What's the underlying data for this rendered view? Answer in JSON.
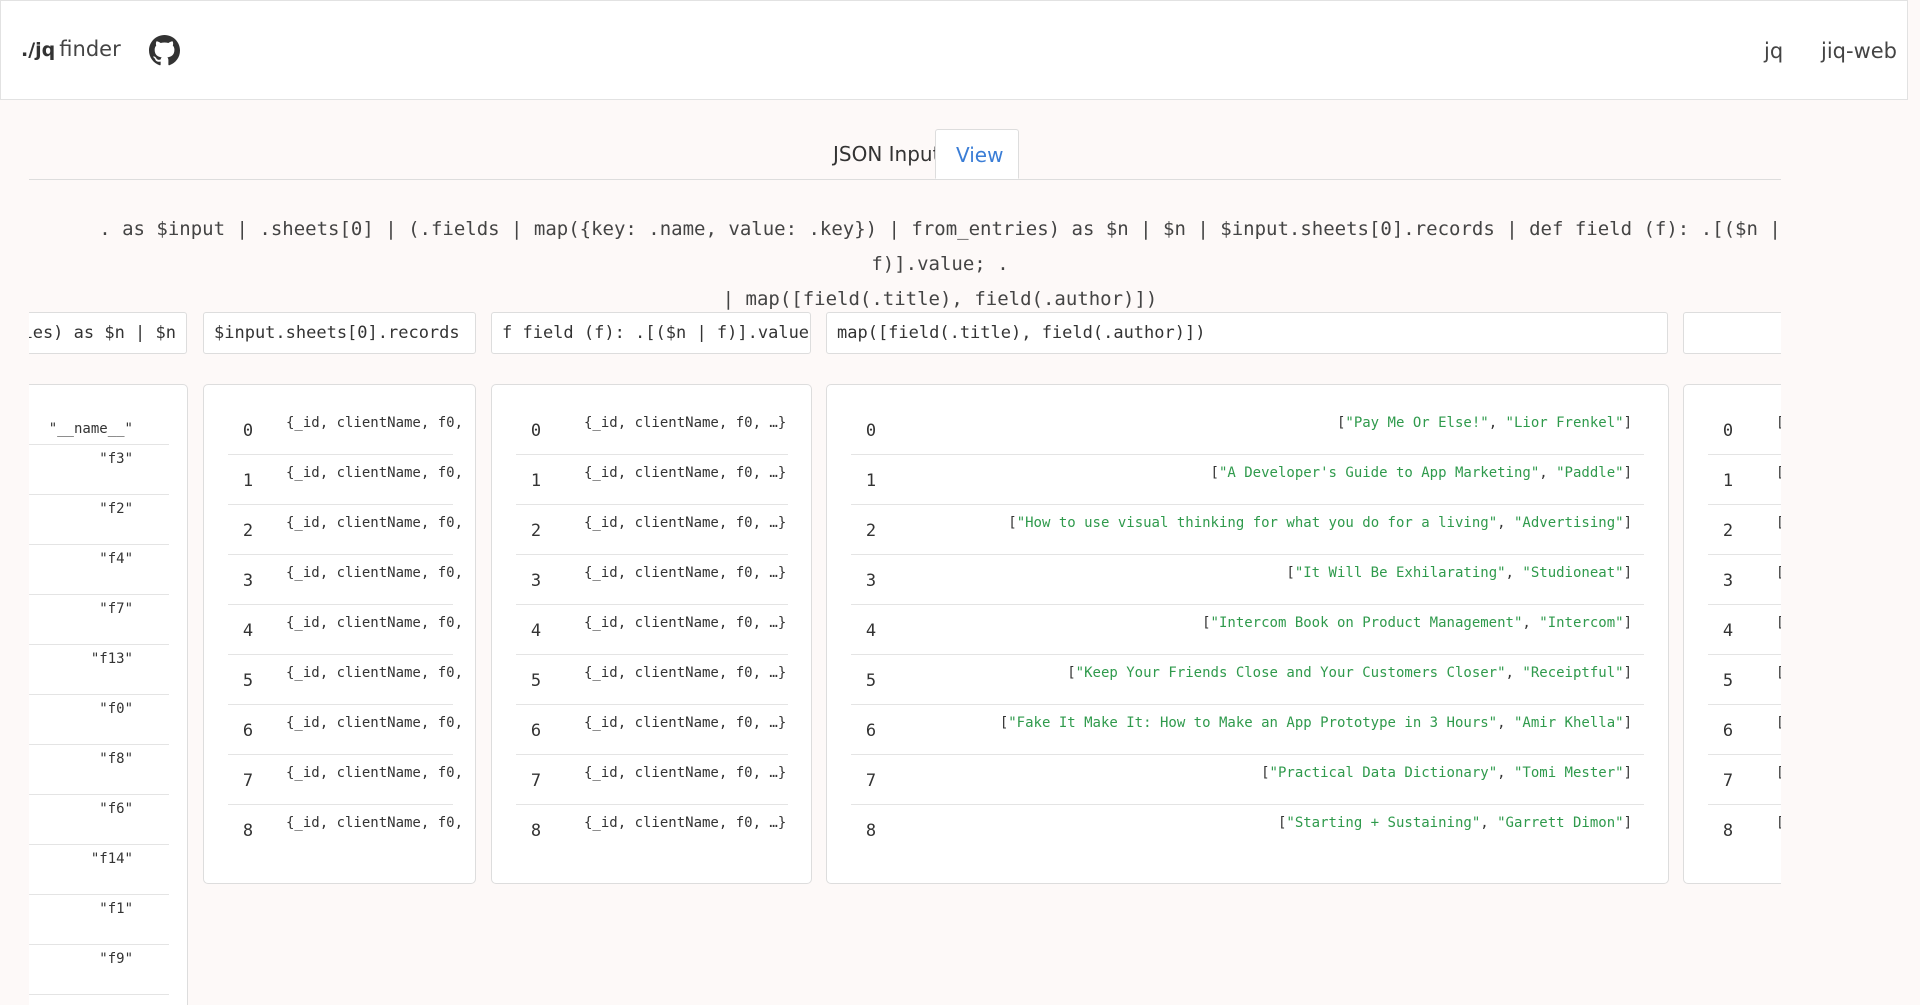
{
  "header": {
    "brand_mark": "./jq",
    "brand_text": "finder",
    "github_icon": "github-icon",
    "nav": [
      "jq",
      "jiq-web"
    ]
  },
  "tabs": [
    {
      "label": "JSON Input",
      "active": false
    },
    {
      "label": "View",
      "active": true
    }
  ],
  "query": {
    "line1": ". as $input | .sheets[0] | (.fields | map({key: .name, value: .key}) | from_entries) as $n | $n | $input.sheets[0].records | def field (f): .[($n | f)].value; .",
    "line2": "| map([field(.title), field(.author)])"
  },
  "filters": [
    "ies) as $n | $n",
    "$input.sheets[0].records",
    "f field (f): .[($n | f)].value",
    "map([field(.title), field(.author)])",
    ""
  ],
  "panel1": {
    "keys": [
      "\"__name__\"",
      "\"f3\"",
      "\"f2\"",
      "\"f4\"",
      "\"f7\"",
      "\"f13\"",
      "\"f0\"",
      "\"f8\"",
      "\"f6\"",
      "\"f14\"",
      "\"f1\"",
      "\"f9\""
    ]
  },
  "panel2": {
    "rows": [
      {
        "i": "0",
        "v": "{_id, clientName, f0,"
      },
      {
        "i": "1",
        "v": "{_id, clientName, f0,"
      },
      {
        "i": "2",
        "v": "{_id, clientName, f0,"
      },
      {
        "i": "3",
        "v": "{_id, clientName, f0,"
      },
      {
        "i": "4",
        "v": "{_id, clientName, f0,"
      },
      {
        "i": "5",
        "v": "{_id, clientName, f0,"
      },
      {
        "i": "6",
        "v": "{_id, clientName, f0,"
      },
      {
        "i": "7",
        "v": "{_id, clientName, f0,"
      },
      {
        "i": "8",
        "v": "{_id, clientName, f0,"
      }
    ]
  },
  "panel3": {
    "rows": [
      {
        "i": "0",
        "v": "{_id, clientName, f0, …}"
      },
      {
        "i": "1",
        "v": "{_id, clientName, f0, …}"
      },
      {
        "i": "2",
        "v": "{_id, clientName, f0, …}"
      },
      {
        "i": "3",
        "v": "{_id, clientName, f0, …}"
      },
      {
        "i": "4",
        "v": "{_id, clientName, f0, …}"
      },
      {
        "i": "5",
        "v": "{_id, clientName, f0, …}"
      },
      {
        "i": "6",
        "v": "{_id, clientName, f0, …}"
      },
      {
        "i": "7",
        "v": "{_id, clientName, f0, …}"
      },
      {
        "i": "8",
        "v": "{_id, clientName, f0, …}"
      }
    ]
  },
  "panel4": {
    "rows": [
      {
        "i": "0",
        "a": "\"Pay Me Or Else!\"",
        "b": "\"Lior Frenkel\""
      },
      {
        "i": "1",
        "a": "\"A Developer's Guide to App Marketing\"",
        "b": "\"Paddle\""
      },
      {
        "i": "2",
        "a": "\"How to use visual thinking for what you do for a living\"",
        "b": "\"Advertising\""
      },
      {
        "i": "3",
        "a": "\"It Will Be Exhilarating\"",
        "b": "\"Studioneat\""
      },
      {
        "i": "4",
        "a": "\"Intercom Book on Product Management\"",
        "b": "\"Intercom\""
      },
      {
        "i": "5",
        "a": "\"Keep Your Friends Close and Your Customers Closer\"",
        "b": "\"Receiptful\""
      },
      {
        "i": "6",
        "a": "\"Fake It Make It: How to Make an App Prototype in 3 Hours\"",
        "b": "\"Amir Khella\""
      },
      {
        "i": "7",
        "a": "\"Practical Data Dictionary\"",
        "b": "\"Tomi Mester\""
      },
      {
        "i": "8",
        "a": "\"Starting + Sustaining\"",
        "b": "\"Garrett Dimon\""
      }
    ]
  },
  "panel5": {
    "rows": [
      {
        "i": "0",
        "v": "["
      },
      {
        "i": "1",
        "v": "["
      },
      {
        "i": "2",
        "v": "["
      },
      {
        "i": "3",
        "v": "["
      },
      {
        "i": "4",
        "v": "["
      },
      {
        "i": "5",
        "v": "["
      },
      {
        "i": "6",
        "v": "["
      },
      {
        "i": "7",
        "v": "["
      },
      {
        "i": "8",
        "v": "["
      }
    ]
  },
  "colors": {
    "string": "#2f9a4c",
    "active_tab": "#3a7dd6",
    "page_bg": "#fdf9f8"
  }
}
